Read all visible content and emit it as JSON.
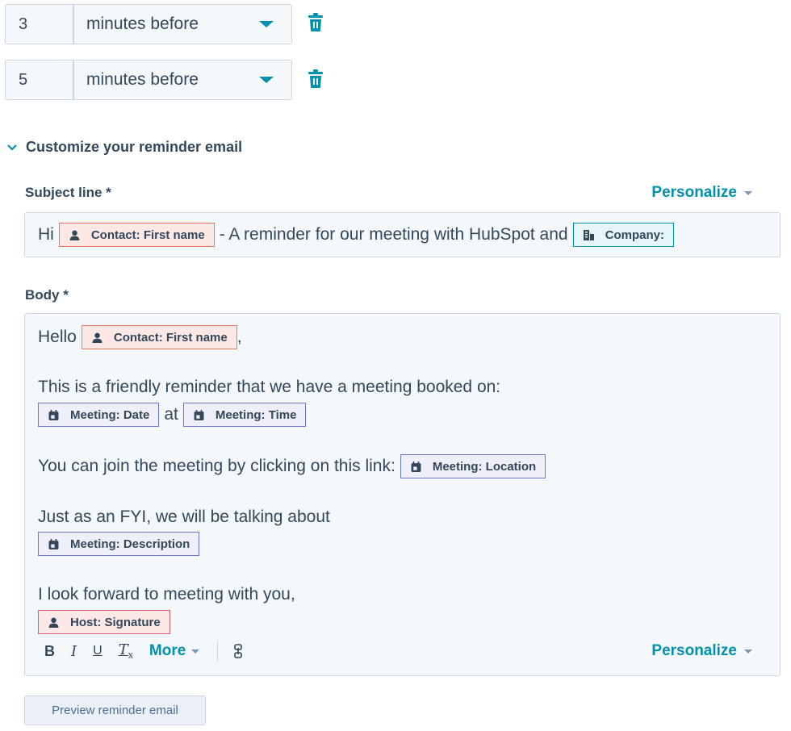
{
  "reminders": [
    {
      "value": "3",
      "unit": "minutes before"
    },
    {
      "value": "5",
      "unit": "minutes before"
    }
  ],
  "section": {
    "title": "Customize your reminder email"
  },
  "subject": {
    "label": "Subject line *",
    "personalize_label": "Personalize",
    "text_hi": "Hi",
    "token_contact": "Contact: First name",
    "text_middle": "- A reminder for our meeting with HubSpot and",
    "token_company": "Company:"
  },
  "body": {
    "label": "Body *",
    "hello": "Hello",
    "token_contact": "Contact: First name",
    "comma": ",",
    "line2": "This is a friendly reminder that we have a meeting booked on:",
    "token_date": "Meeting: Date",
    "at": "at",
    "token_time": "Meeting: Time",
    "line4": "You can join the meeting by clicking on this link:",
    "token_location": "Meeting: Location",
    "line5": "Just as an FYI, we will be talking about",
    "token_description": "Meeting: Description",
    "line7": "I look forward to meeting with you,",
    "token_signature": "Host: Signature"
  },
  "toolbar": {
    "bold": "B",
    "italic": "I",
    "underline": "U",
    "clear_format": "T",
    "more_label": "More",
    "personalize_label": "Personalize"
  },
  "preview_button": "Preview reminder email",
  "colors": {
    "accent": "#0091ae",
    "text": "#33475b",
    "contact_token_border": "#f2765f",
    "meeting_token_border": "#6a78d1",
    "company_token_border": "#0091ae"
  }
}
